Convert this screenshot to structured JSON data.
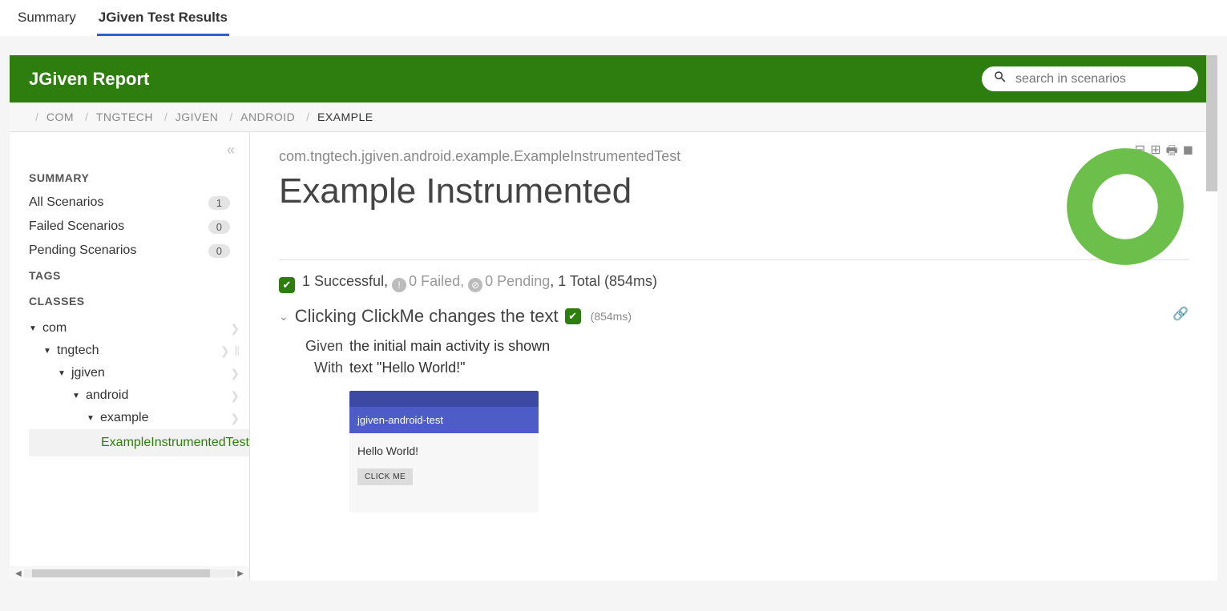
{
  "topTabs": {
    "summary": "Summary",
    "results": "JGiven Test Results"
  },
  "header": {
    "title": "JGiven Report",
    "searchPlaceholder": "search in scenarios"
  },
  "breadcrumbs": [
    "COM",
    "TNGTECH",
    "JGIVEN",
    "ANDROID",
    "EXAMPLE"
  ],
  "sidebar": {
    "summaryTitle": "SUMMARY",
    "tagsTitle": "TAGS",
    "classesTitle": "CLASSES",
    "rows": {
      "all": {
        "label": "All Scenarios",
        "count": "1"
      },
      "failed": {
        "label": "Failed Scenarios",
        "count": "0"
      },
      "pending": {
        "label": "Pending Scenarios",
        "count": "0"
      }
    },
    "tree": {
      "l1": "com",
      "l2": "tngtech",
      "l3": "jgiven",
      "l4": "android",
      "l5": "example",
      "leaf": "ExampleInstrumentedTest"
    }
  },
  "main": {
    "qualified": "com.tngtech.jgiven.android.example.ExampleInstrumentedTest",
    "title": "Example Instrumented",
    "stats": {
      "successCount": "1 Successful,",
      "failedCount": "0 Failed,",
      "pendingCount": "0 Pending",
      "totalText": ", 1 Total (854ms)"
    },
    "scenario": {
      "title": "Clicking ClickMe changes the text",
      "duration": "(854ms)",
      "givenKw": "Given",
      "givenTxt": "the initial main activity is shown",
      "withKw": "With",
      "withTxt": "text \"Hello World!\""
    },
    "mock": {
      "appbar": "jgiven-android-test",
      "bodyText": "Hello World!",
      "button": "CLICK ME"
    }
  }
}
